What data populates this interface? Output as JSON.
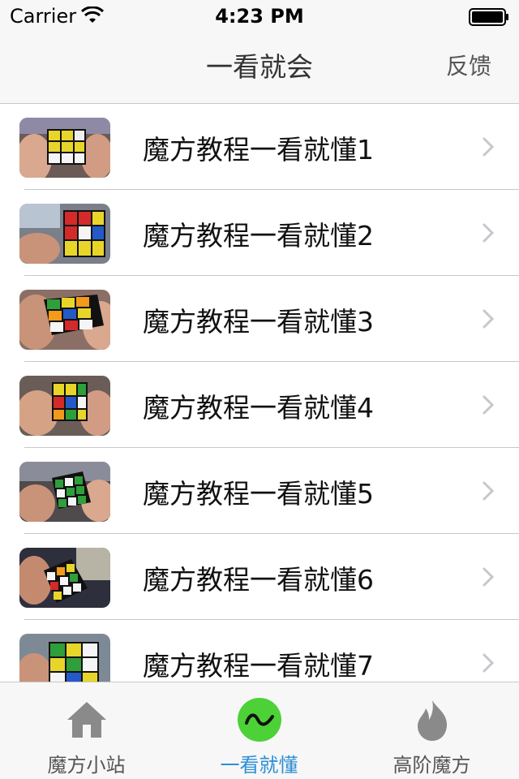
{
  "status_bar": {
    "carrier": "Carrier",
    "time": "4:23 PM"
  },
  "nav": {
    "title": "一看就会",
    "right_button": "反馈"
  },
  "list": {
    "items": [
      {
        "label": "魔方教程一看就懂1"
      },
      {
        "label": "魔方教程一看就懂2"
      },
      {
        "label": "魔方教程一看就懂3"
      },
      {
        "label": "魔方教程一看就懂4"
      },
      {
        "label": "魔方教程一看就懂5"
      },
      {
        "label": "魔方教程一看就懂6"
      },
      {
        "label": "魔方教程一看就懂7"
      }
    ]
  },
  "tabbar": {
    "tabs": [
      {
        "label": "魔方小站",
        "icon": "home-icon",
        "active": false
      },
      {
        "label": "一看就懂",
        "icon": "wave-icon",
        "active": true
      },
      {
        "label": "高阶魔方",
        "icon": "flame-icon",
        "active": false
      }
    ]
  },
  "colors": {
    "active_tab": "#2e8fd6",
    "wave_icon_bg": "#4cd137",
    "inactive_icon": "#8a8a8a"
  }
}
